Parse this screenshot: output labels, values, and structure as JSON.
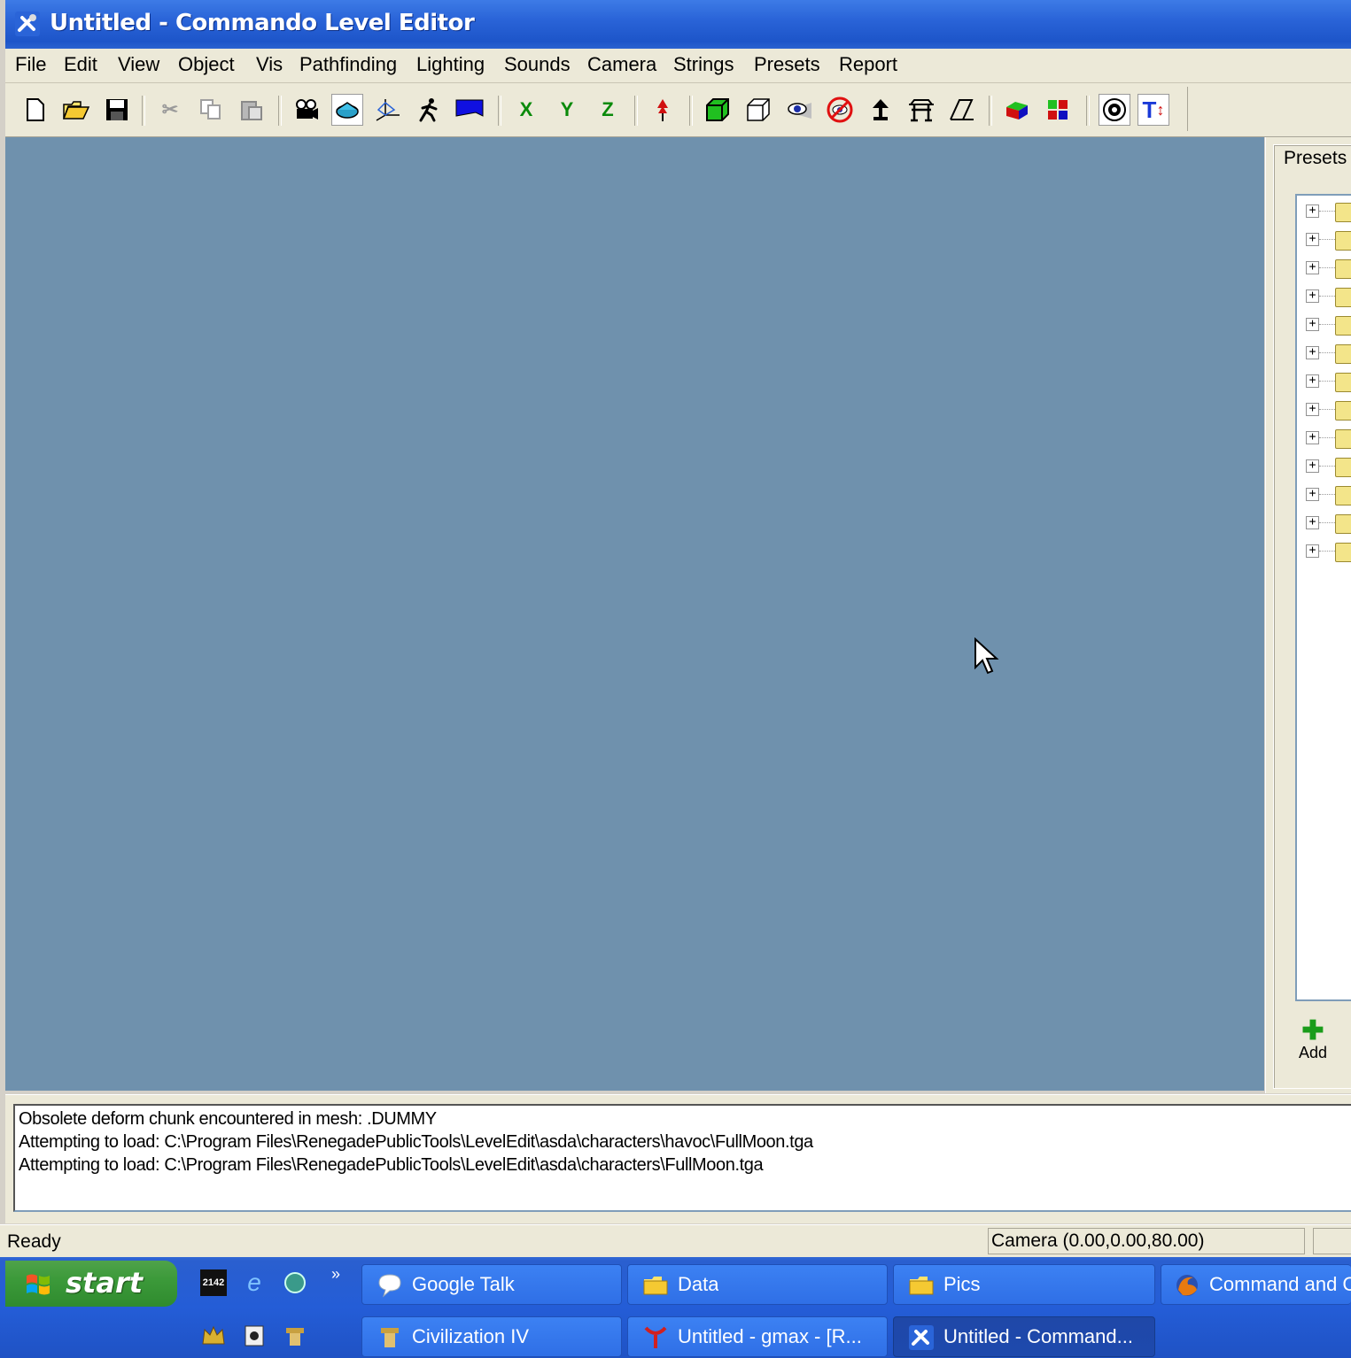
{
  "window": {
    "title": "Untitled - Commando Level Editor",
    "icon": "tools-icon"
  },
  "menu": [
    "File",
    "Edit",
    "View",
    "Object",
    "Vis",
    "Pathfinding",
    "Lighting",
    "Sounds",
    "Camera",
    "Strings",
    "Presets",
    "Report"
  ],
  "toolbar": {
    "buttons": [
      "new-file-icon",
      "open-folder-icon",
      "save-disk-icon",
      "cut-icon",
      "copy-icon",
      "paste-icon",
      "camera-icon",
      "select-object-icon",
      "gizmo-icon",
      "walk-mode-icon",
      "flag-icon",
      "axis-x",
      "axis-y",
      "axis-z",
      "drop-marker-icon",
      "solid-box-icon",
      "wire-box-icon",
      "eye-icon",
      "hide-icon",
      "lamp-icon",
      "bench-icon",
      "tilt-icon",
      "cube-color-icon",
      "color-blocks-icon",
      "visibility-icon",
      "text-sort-icon"
    ],
    "axis_x": "X",
    "axis_y": "Y",
    "axis_z": "Z",
    "text_tool": "T"
  },
  "presets": {
    "label": "Presets",
    "tree_rows": 13,
    "add_label": "Add"
  },
  "log": {
    "lines": [
      "Obsolete deform chunk encountered in mesh: .DUMMY",
      "Attempting to load: C:\\Program Files\\RenegadePublicTools\\LevelEdit\\asda\\characters\\havoc\\FullMoon.tga",
      "Attempting to load: C:\\Program Files\\RenegadePublicTools\\LevelEdit\\asda\\characters\\FullMoon.tga"
    ]
  },
  "status": {
    "ready": "Ready",
    "camera": "Camera (0.00,0.00,80.00)"
  },
  "taskbar": {
    "start": "start",
    "quicklaunch_more": "»",
    "tasks_row1": [
      "Google Talk",
      "Data",
      "Pics",
      "Command and Co"
    ],
    "tasks_row2": [
      "Civilization IV",
      "Untitled - gmax - [R...",
      "Untitled - Command..."
    ]
  },
  "colors": {
    "viewport": "#6f91ad",
    "titlebar": "#2a64d8",
    "chrome": "#ece9d8"
  }
}
